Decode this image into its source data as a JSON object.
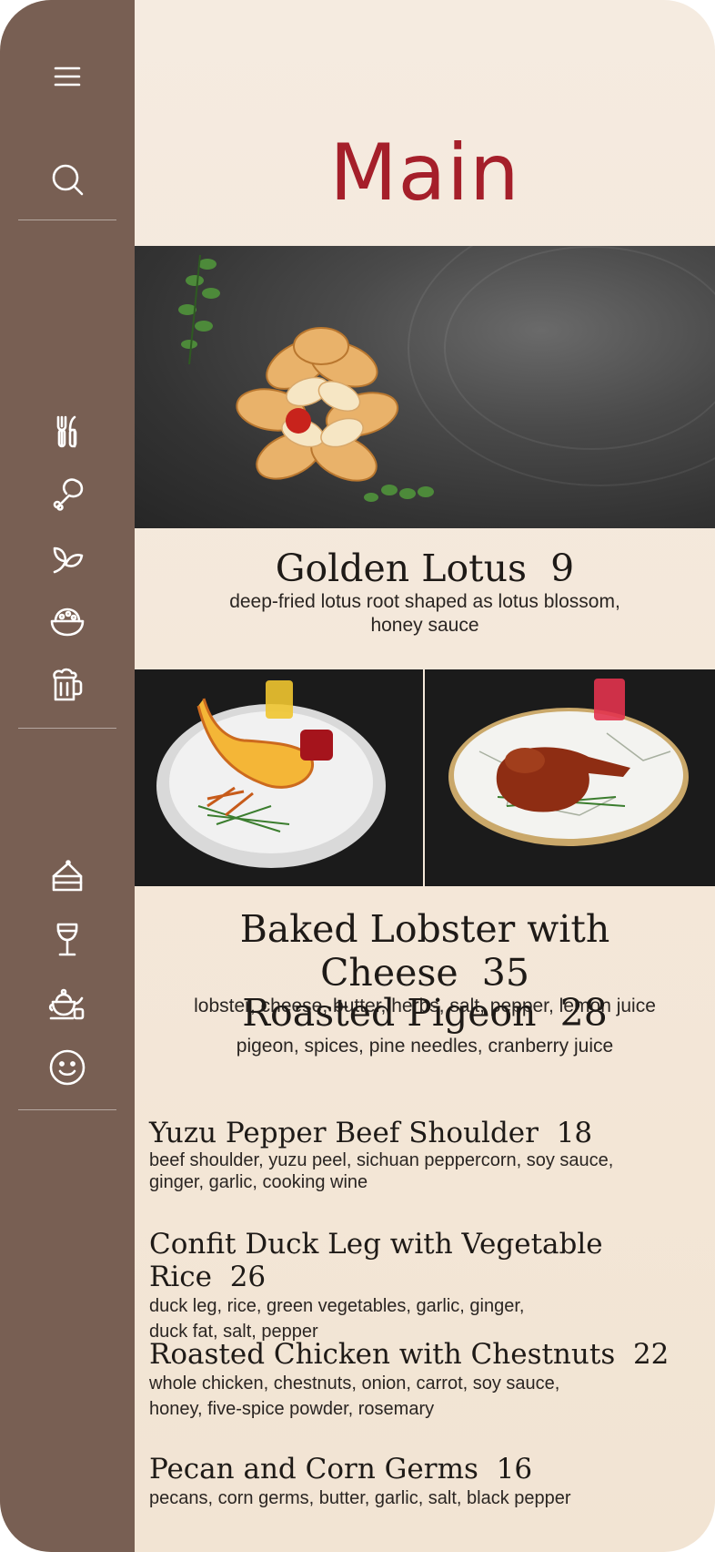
{
  "page": {
    "title": "Main"
  },
  "sidebar": {
    "top_icons": [
      "menu-icon",
      "search-icon"
    ],
    "category_icons": [
      "fork-knife-icon",
      "drumstick-icon",
      "leaf-icon",
      "bowl-icon",
      "beer-mug-icon"
    ],
    "extra_icons": [
      "cake-icon",
      "wine-glass-icon",
      "teapot-icon",
      "smiley-icon"
    ]
  },
  "featured": {
    "name": "Golden Lotus",
    "price": "9",
    "description_line1": "deep-fried lotus root shaped as lotus blossom,",
    "description_line2": "honey sauce"
  },
  "pair": [
    {
      "name": "Baked Lobster with Cheese",
      "price": "35",
      "description": "lobster, cheese, butter, herbs,  salt, pepper, lemon juice"
    },
    {
      "name": "Roasted Pigeon",
      "price": "28",
      "description": "pigeon, spices, pine needles, cranberry juice"
    }
  ],
  "list": [
    {
      "name": "Yuzu Pepper Beef Shoulder",
      "price": "18",
      "line1": "beef shoulder, yuzu peel, sichuan peppercorn, soy sauce,",
      "line2": "ginger, garlic, cooking wine"
    },
    {
      "name": "Confit Duck Leg with Vegetable Rice",
      "price": "26",
      "line1": "duck leg, rice, green vegetables, garlic, ginger,",
      "line2": "duck fat, salt, pepper"
    },
    {
      "name": "Roasted Chicken with Chestnuts",
      "price": "22",
      "line1": "whole chicken, chestnuts, onion, carrot, soy sauce,",
      "line2": "honey, five-spice powder, rosemary"
    },
    {
      "name": "Pecan and Corn Germs",
      "price": "16",
      "line1": "pecans, corn germs, butter, garlic, salt, black pepper",
      "line2": ""
    }
  ],
  "colors": {
    "sidebar": "#785f53",
    "title": "#a51f2a",
    "background": "#f5ebe0"
  }
}
